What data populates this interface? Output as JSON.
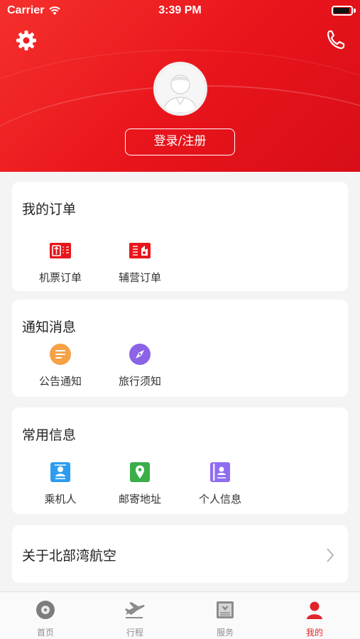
{
  "status_bar": {
    "carrier": "Carrier",
    "time": "3:39 PM"
  },
  "header": {
    "login_label": "登录/注册"
  },
  "orders": {
    "title": "我的订单",
    "items": [
      {
        "label": "机票订单",
        "icon": "ticket-icon"
      },
      {
        "label": "辅营订单",
        "icon": "ancillary-ticket-icon"
      }
    ]
  },
  "notices": {
    "title": "通知消息",
    "items": [
      {
        "label": "公告通知",
        "icon": "announcement-icon"
      },
      {
        "label": "旅行须知",
        "icon": "compass-icon"
      }
    ]
  },
  "common_info": {
    "title": "常用信息",
    "items": [
      {
        "label": "乘机人",
        "icon": "passenger-card-icon"
      },
      {
        "label": "邮寄地址",
        "icon": "map-pin-icon"
      },
      {
        "label": "个人信息",
        "icon": "id-card-icon"
      }
    ]
  },
  "about": {
    "label": "关于北部湾航空"
  },
  "tabs": [
    {
      "label": "首页",
      "icon": "home-disc-icon"
    },
    {
      "label": "行程",
      "icon": "airplane-icon"
    },
    {
      "label": "服务",
      "icon": "newspaper-icon"
    },
    {
      "label": "我的",
      "icon": "person-icon",
      "active": true
    }
  ],
  "colors": {
    "brand_red": "#e8141b",
    "active_tab": "#e0242a",
    "announcement": "#f5a145",
    "compass": "#8a63e6",
    "passenger": "#2d9cf0",
    "address": "#3aae49",
    "personal": "#8f6df0"
  }
}
